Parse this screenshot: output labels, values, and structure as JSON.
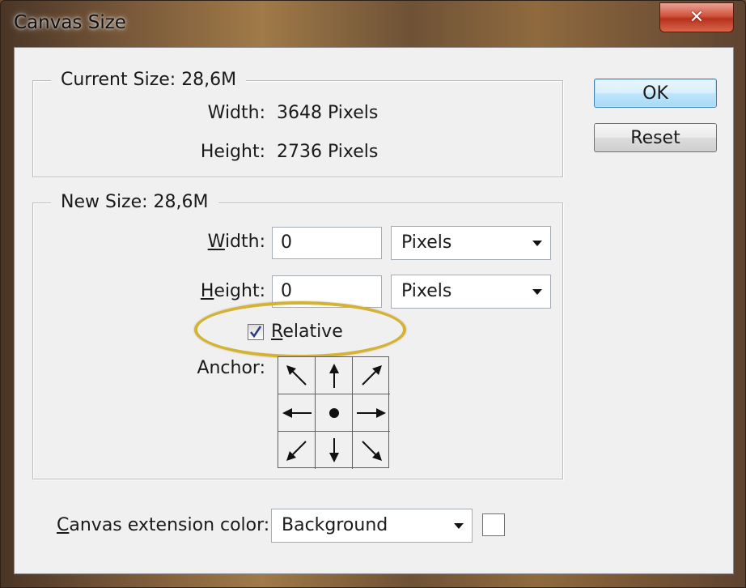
{
  "window": {
    "title": "Canvas Size",
    "close_glyph": "✕"
  },
  "current_size": {
    "label": "Current Size: 28,6M",
    "width_label": "Width:",
    "width_value": "3648 Pixels",
    "height_label": "Height:",
    "height_value": "2736 Pixels"
  },
  "new_size": {
    "label": "New Size: 28,6M",
    "width_label_first": "W",
    "width_label_rest": "idth:",
    "width_value": "0",
    "width_unit": "Pixels",
    "height_label_first": "H",
    "height_label_rest": "eight:",
    "height_value": "0",
    "height_unit": "Pixels",
    "relative_label_first": "R",
    "relative_label_rest": "elative",
    "relative_checked": true,
    "anchor_label": "Anchor:",
    "anchor_icons": [
      "arrow-up-left-icon",
      "arrow-up-icon",
      "arrow-up-right-icon",
      "arrow-left-icon",
      "anchor-center-dot-icon",
      "arrow-right-icon",
      "arrow-down-left-icon",
      "arrow-down-icon",
      "arrow-down-right-icon"
    ]
  },
  "extension": {
    "label_first": "C",
    "label_rest": "anvas extension color:",
    "value": "Background",
    "swatch_color": "#ffffff"
  },
  "buttons": {
    "ok_label": "OK",
    "reset_label": "Reset"
  },
  "colors": {
    "highlight_ellipse": "#d4b233",
    "default_button": "#3c7fb1",
    "dialog_bg": "#f0f0f0"
  }
}
